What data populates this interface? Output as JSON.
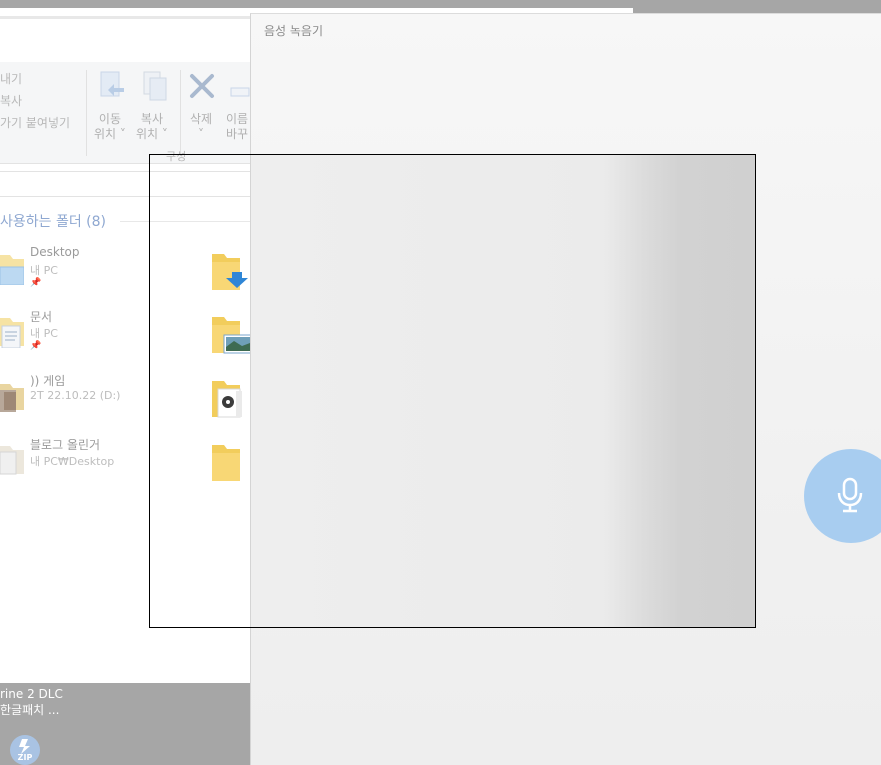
{
  "explorer": {
    "ribbon": {
      "clipboard_partial": [
        "내기",
        "복사",
        "가기 붙여넣기"
      ],
      "move_to": [
        "이동",
        "위치 ˅"
      ],
      "copy_to": [
        "복사",
        "위치 ˅"
      ],
      "delete": [
        "삭제",
        "˅"
      ],
      "rename_partial": [
        "이름",
        "바꾸"
      ],
      "group_label": "구성"
    },
    "quick_access": {
      "title": "사용하는 폴더 (8)",
      "items": [
        {
          "name": "Desktop",
          "location": "내 PC"
        },
        {
          "name": "문서",
          "location": "내 PC"
        },
        {
          "name": ")) 게임",
          "location": "2T 22.10.22 (D:)"
        },
        {
          "name": "블로그 올린거",
          "location": "내 PC₩Desktop"
        }
      ]
    }
  },
  "taskbar": {
    "item_line1": "rine 2 DLC",
    "item_line2": "한글패치 ...",
    "zip_label": "ZIP"
  },
  "recorder": {
    "title": "음성 녹음기",
    "mic_button": "microphone-icon"
  },
  "colors": {
    "accent": "#a8cdf0",
    "section_title": "#8fa8d1",
    "selection_border": "#000000"
  }
}
